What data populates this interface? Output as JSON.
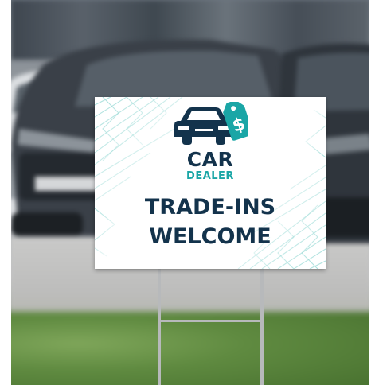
{
  "sign": {
    "brand_line_1": "CAR",
    "brand_line_2": "DEALER",
    "headline_line_1": "TRADE-INS",
    "headline_line_2": "WELCOME",
    "price_tag_symbol": "$"
  },
  "colors": {
    "navy": "#13334c",
    "teal": "#1aa6a6",
    "sign_background": "#ffffff",
    "stake": "#b7b9bb"
  },
  "icons": [
    "car-icon",
    "price-tag-icon"
  ]
}
